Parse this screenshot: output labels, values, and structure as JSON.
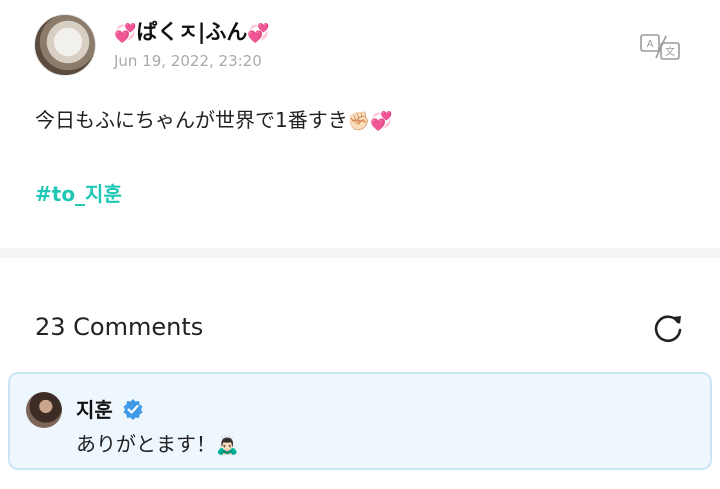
{
  "post": {
    "author_heart_left": "💞",
    "author_name": "ぱくㅈ|ふん",
    "author_heart_right": "💞",
    "date": "Jun 19, 2022, 23:20",
    "translate_icon": "translate-icon",
    "body_text": "今日もふにちゃんが世界で1番すき",
    "body_emoji": "✊🏻💞",
    "hashtag": "#to_지훈"
  },
  "comments": {
    "header": "23 Comments",
    "refresh_icon": "refresh-icon",
    "items": [
      {
        "name": "지훈",
        "verified": true,
        "text": "ありがとます！",
        "emoji": "🙇🏻‍♂️"
      }
    ]
  },
  "colors": {
    "hashtag": "#1fc8b5",
    "heart": "#f0449a",
    "comment_bg": "#eef7fd",
    "comment_border": "#c9e6f4",
    "verified": "#3f9ae8"
  }
}
